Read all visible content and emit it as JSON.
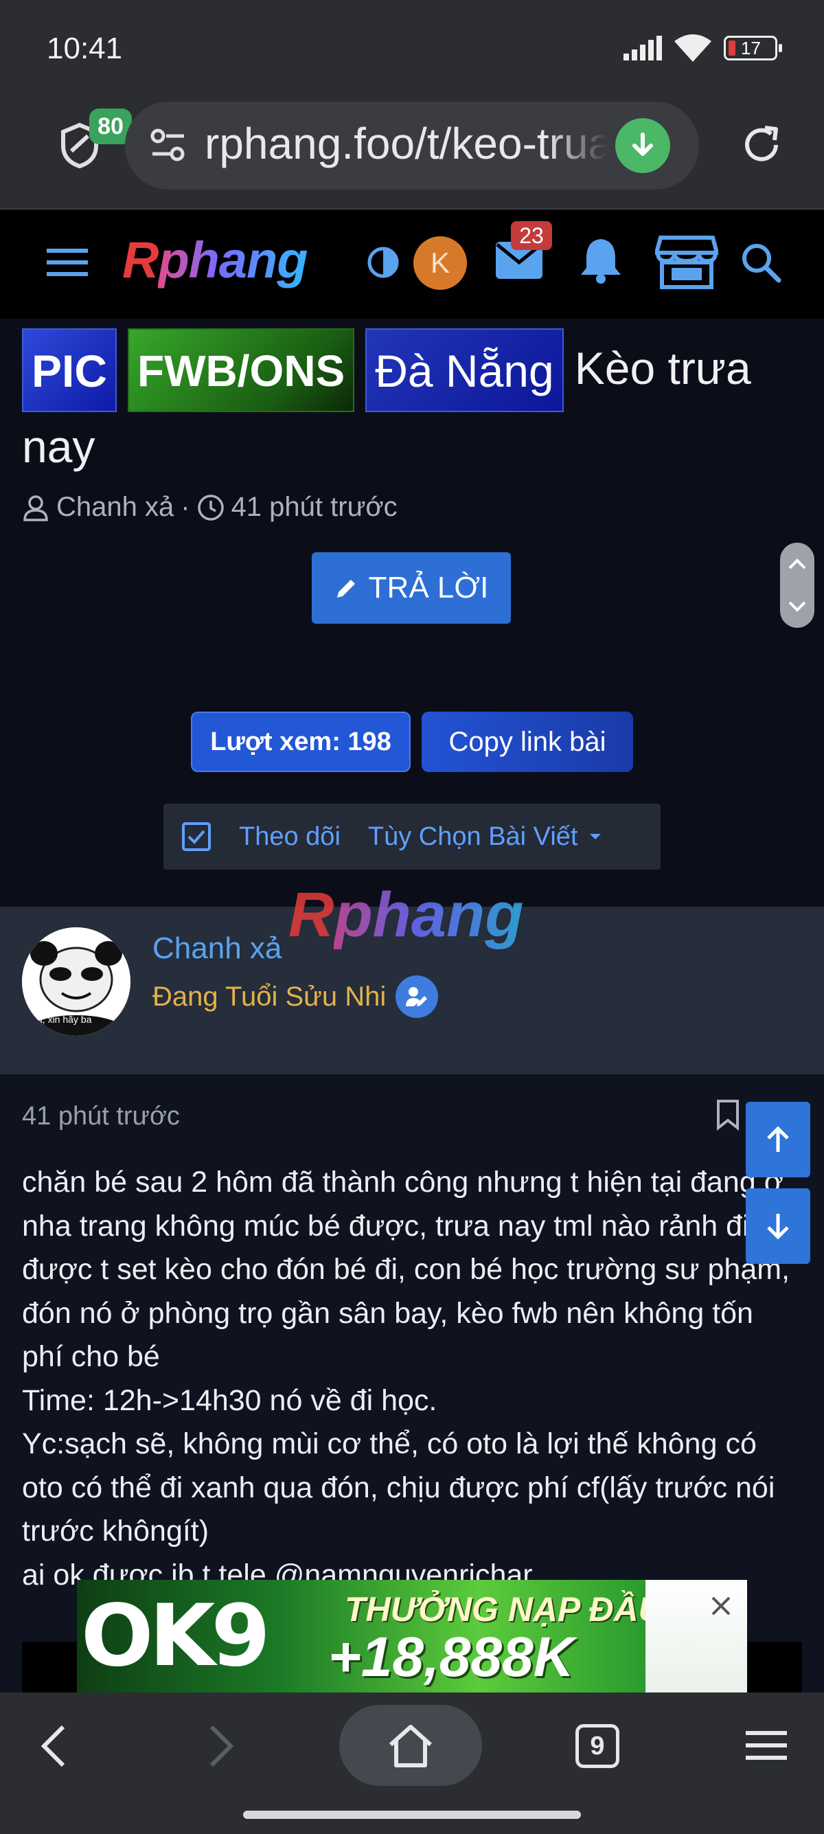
{
  "status_bar": {
    "time": "10:41",
    "battery": "17"
  },
  "browser": {
    "shield_count": "80",
    "url": "rphang.foo/t/keo-trua-nay",
    "icons": [
      "shield-icon",
      "tune-icon",
      "download-icon",
      "reload-icon"
    ]
  },
  "site_header": {
    "logo_first": "R",
    "logo_rest": "phang",
    "user_initial": "K",
    "inbox_count": "23"
  },
  "thread": {
    "tags": [
      "PIC",
      "FWB/ONS",
      "Đà Nẵng"
    ],
    "title_line1": "Kèo trưa",
    "title_line2": "nay",
    "author": "Chanh xả",
    "separator": "·",
    "time": "41 phút trước",
    "reply_label": "TRẢ LỜI",
    "views_label": "Lượt xem: 198",
    "copy_label": "Copy link bài",
    "follow_label": "Theo dõi",
    "options_label": "Tùy Chọn Bài Viết"
  },
  "author_panel": {
    "watermark_first": "R",
    "watermark_rest": "phang",
    "name": "Chanh xả",
    "rank": "Đang Tuổi Sửu Nhi",
    "avatar_caption": "à, xin hãy ba"
  },
  "post": {
    "time": "41 phút trước",
    "body": "chăn bé sau 2 hôm đã thành công nhưng t hiện tại đang ở nha trang không múc bé được, trưa nay tml nào rảnh đi được t set kèo cho đón bé đi, con bé học trường sư phạm, đón nó ở phòng trọ gần sân bay, kèo fwb nên không tốn phí cho bé\nTime: 12h->14h30 nó về đi học.\nYc:sạch sẽ, không mùi cơ thể, có oto là lợi thế không có oto có thể đi xanh qua đón, chịu được phí cf(lấy trước nói trước khôngít)\nai ok được ib t tele @namnguyenrichar"
  },
  "ad": {
    "logo": "OK9",
    "promo_line1": "THƯỞNG NẠP ĐẦU",
    "promo_line2": "+18,888K"
  },
  "bottom_nav": {
    "tab_count": "9"
  },
  "colors": {
    "accent": "#2e6fd6",
    "link": "#5aa3ef",
    "rank": "#e2b24a",
    "badge_red": "#c33b3b",
    "badge_green": "#3aa35b"
  }
}
